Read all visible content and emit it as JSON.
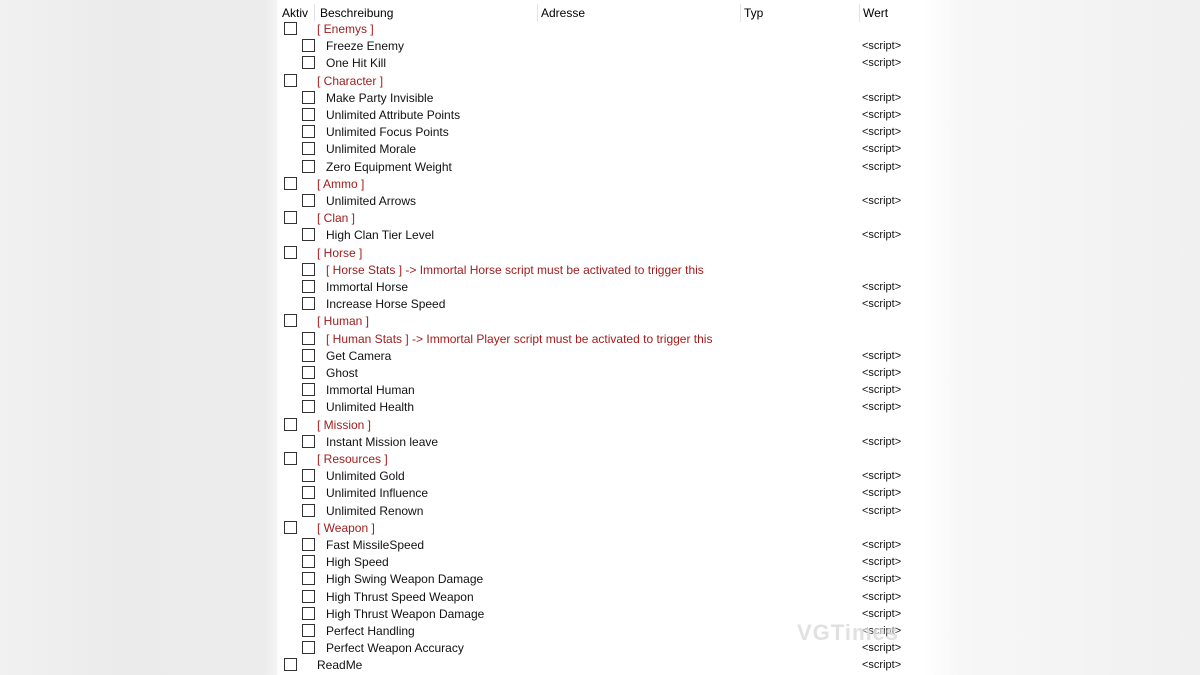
{
  "columns": {
    "active": "Aktiv",
    "description": "Beschreibung",
    "address": "Adresse",
    "type": "Typ",
    "value": "Wert"
  },
  "rows": [
    {
      "level": 0,
      "kind": "group",
      "label": "[ Enemys ]",
      "value": ""
    },
    {
      "level": 1,
      "kind": "item",
      "label": "Freeze Enemy",
      "value": "<script>"
    },
    {
      "level": 1,
      "kind": "item",
      "label": "One Hit Kill",
      "value": "<script>"
    },
    {
      "level": 0,
      "kind": "group",
      "label": "[ Character ]",
      "value": ""
    },
    {
      "level": 1,
      "kind": "item",
      "label": "Make Party Invisible",
      "value": "<script>"
    },
    {
      "level": 1,
      "kind": "item",
      "label": "Unlimited Attribute Points",
      "value": "<script>"
    },
    {
      "level": 1,
      "kind": "item",
      "label": "Unlimited Focus Points",
      "value": "<script>"
    },
    {
      "level": 1,
      "kind": "item",
      "label": "Unlimited Morale",
      "value": "<script>"
    },
    {
      "level": 1,
      "kind": "item",
      "label": "Zero Equipment Weight",
      "value": "<script>"
    },
    {
      "level": 0,
      "kind": "group",
      "label": "[ Ammo ]",
      "value": ""
    },
    {
      "level": 1,
      "kind": "item",
      "label": "Unlimited Arrows",
      "value": "<script>"
    },
    {
      "level": 0,
      "kind": "group",
      "label": "[ Clan ]",
      "value": ""
    },
    {
      "level": 1,
      "kind": "item",
      "label": "High Clan Tier Level",
      "value": "<script>"
    },
    {
      "level": 0,
      "kind": "group",
      "label": "[ Horse ]",
      "value": ""
    },
    {
      "level": 1,
      "kind": "note",
      "label": "[ Horse Stats ] -> Immortal Horse script must be activated to trigger this",
      "value": ""
    },
    {
      "level": 1,
      "kind": "item",
      "label": "Immortal Horse",
      "value": "<script>"
    },
    {
      "level": 1,
      "kind": "item",
      "label": "Increase Horse Speed",
      "value": "<script>"
    },
    {
      "level": 0,
      "kind": "group",
      "label": "[ Human ]",
      "value": ""
    },
    {
      "level": 1,
      "kind": "note",
      "label": "[ Human Stats ] -> Immortal Player script must be activated to trigger this",
      "value": ""
    },
    {
      "level": 1,
      "kind": "item",
      "label": "Get Camera",
      "value": "<script>"
    },
    {
      "level": 1,
      "kind": "item",
      "label": "Ghost",
      "value": "<script>"
    },
    {
      "level": 1,
      "kind": "item",
      "label": "Immortal Human",
      "value": "<script>"
    },
    {
      "level": 1,
      "kind": "item",
      "label": "Unlimited Health",
      "value": "<script>"
    },
    {
      "level": 0,
      "kind": "group",
      "label": "[ Mission ]",
      "value": ""
    },
    {
      "level": 1,
      "kind": "item",
      "label": "Instant Mission leave",
      "value": "<script>"
    },
    {
      "level": 0,
      "kind": "group",
      "label": "[ Resources ]",
      "value": ""
    },
    {
      "level": 1,
      "kind": "item",
      "label": "Unlimited Gold",
      "value": "<script>"
    },
    {
      "level": 1,
      "kind": "item",
      "label": "Unlimited Influence",
      "value": "<script>"
    },
    {
      "level": 1,
      "kind": "item",
      "label": "Unlimited Renown",
      "value": "<script>"
    },
    {
      "level": 0,
      "kind": "group",
      "label": "[ Weapon ]",
      "value": ""
    },
    {
      "level": 1,
      "kind": "item",
      "label": "Fast MissileSpeed",
      "value": "<script>"
    },
    {
      "level": 1,
      "kind": "item",
      "label": "High Speed",
      "value": "<script>"
    },
    {
      "level": 1,
      "kind": "item",
      "label": "High Swing Weapon Damage",
      "value": "<script>"
    },
    {
      "level": 1,
      "kind": "item",
      "label": "High Thrust Speed Weapon",
      "value": "<script>"
    },
    {
      "level": 1,
      "kind": "item",
      "label": "High Thrust Weapon Damage",
      "value": "<script>"
    },
    {
      "level": 1,
      "kind": "item",
      "label": "Perfect Handling",
      "value": "<script>"
    },
    {
      "level": 1,
      "kind": "item",
      "label": "Perfect Weapon Accuracy",
      "value": "<script>"
    },
    {
      "level": 0,
      "kind": "item",
      "label": "ReadMe",
      "value": "<script>"
    }
  ],
  "watermark": "VGTimes",
  "colors": {
    "group_text": "#9b1c1c",
    "item_text": "#111111"
  }
}
